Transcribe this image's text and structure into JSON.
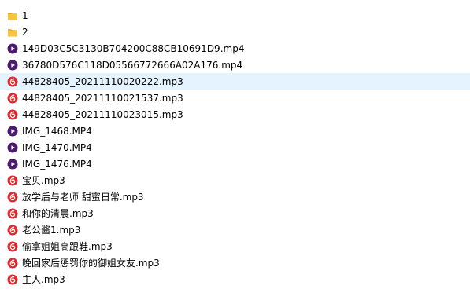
{
  "colors": {
    "folder": "#f5c542",
    "folder_dark": "#e3a91f",
    "video": "#4b1a6e",
    "audio": "#e0282c",
    "selected_row": "#e5f3ff"
  },
  "files": [
    {
      "name": "1",
      "icon": "folder-icon"
    },
    {
      "name": "2",
      "icon": "folder-icon"
    },
    {
      "name": "149D03C5C3130B704200C88CB10691D9.mp4",
      "icon": "video-file-icon"
    },
    {
      "name": "36780D576C118D05566772666A02A176.mp4",
      "icon": "video-file-icon"
    },
    {
      "name": "44828405_20211110020222.mp3",
      "icon": "audio-file-icon",
      "selected": true
    },
    {
      "name": "44828405_20211110021537.mp3",
      "icon": "audio-file-icon"
    },
    {
      "name": "44828405_20211110023015.mp3",
      "icon": "audio-file-icon"
    },
    {
      "name": "IMG_1468.MP4",
      "icon": "video-file-icon"
    },
    {
      "name": "IMG_1470.MP4",
      "icon": "video-file-icon"
    },
    {
      "name": "IMG_1476.MP4",
      "icon": "video-file-icon"
    },
    {
      "name": "宝贝.mp3",
      "icon": "audio-file-icon"
    },
    {
      "name": "放学后与老师 甜蜜日常.mp3",
      "icon": "audio-file-icon"
    },
    {
      "name": "和你的清晨.mp3",
      "icon": "audio-file-icon"
    },
    {
      "name": "老公酱1.mp3",
      "icon": "audio-file-icon"
    },
    {
      "name": "偷拿姐姐高跟鞋.mp3",
      "icon": "audio-file-icon"
    },
    {
      "name": "晚回家后惩罚你的御姐女友.mp3",
      "icon": "audio-file-icon"
    },
    {
      "name": "主人.mp3",
      "icon": "audio-file-icon"
    }
  ]
}
